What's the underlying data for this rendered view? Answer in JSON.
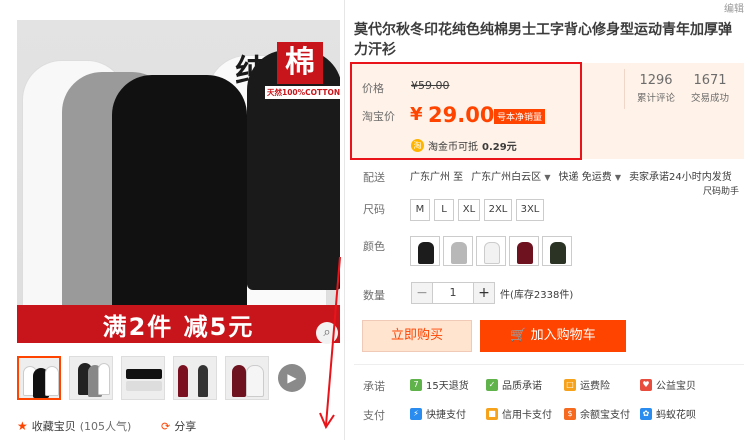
{
  "header": {
    "edit_label": "编辑"
  },
  "gallery": {
    "badge_char1": "纯",
    "badge_char2": "棉",
    "badge_sub": "天然100%COTTON",
    "banner": "满2件  减5元",
    "zoom_icon": "magnifier-icon",
    "play_icon": "play-icon",
    "fav_label": "收藏宝贝",
    "fav_count": "(105人气)",
    "share_label": "分享"
  },
  "product": {
    "title": "莫代尔秋冬印花纯色纯棉男士工字背心修身型运动青年加厚弹力汗衫"
  },
  "price": {
    "label": "价格",
    "original": "¥59.00",
    "tb_label": "淘宝价",
    "currency": "¥",
    "value": "29.00",
    "tag": "号本净销量",
    "coin_text": "淘金币可抵",
    "coin_value": "0.29元",
    "reviews_count": "1296",
    "reviews_label": "累计评论",
    "sales_count": "1671",
    "sales_label": "交易成功"
  },
  "shipping": {
    "label": "配送",
    "from": "广东广州 至",
    "to": "广东广州白云区",
    "method": "快递 免运费",
    "promise": "卖家承诺24小时内发货",
    "size_helper": "尺码助手"
  },
  "size": {
    "label": "尺码",
    "options": [
      "M",
      "L",
      "XL",
      "2XL",
      "3XL"
    ]
  },
  "color": {
    "label": "颜色",
    "swatches": [
      "#1c1c1c",
      "#b8b8b8",
      "#f2f2f2",
      "#6e1220",
      "#2b3324"
    ]
  },
  "quantity": {
    "label": "数量",
    "value": "1",
    "minus": "−",
    "plus": "+",
    "stock": "件(库存2338件)"
  },
  "actions": {
    "buy": "立即购买",
    "cart": "加入购物车"
  },
  "promises": {
    "label": "承诺",
    "items": [
      "15天退货",
      "品质承诺",
      "运费险",
      "公益宝贝"
    ]
  },
  "payment": {
    "label": "支付",
    "items": [
      "快捷支付",
      "信用卡支付",
      "余额宝支付",
      "蚂蚁花呗"
    ]
  },
  "colors": {
    "accent": "#ff4400",
    "highlight": "#e8141a",
    "price_bg": "#fff2e8"
  }
}
